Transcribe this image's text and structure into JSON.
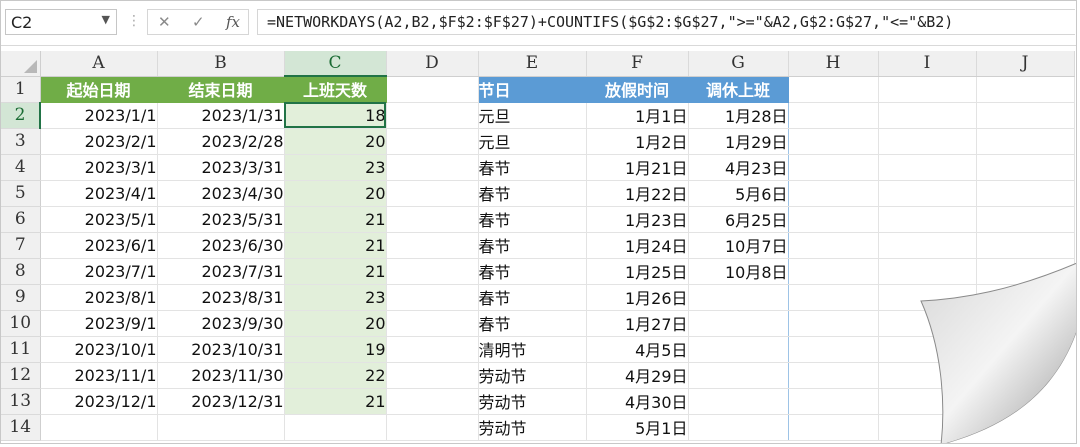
{
  "formula_bar": {
    "cell_ref": "C2",
    "cancel_icon": "✕",
    "enter_icon": "✓",
    "fx_label": "fx",
    "formula": "=NETWORKDAYS(A2,B2,$F$2:$F$27)+COUNTIFS($G$2:$G$27,\">=\"&A2,G$2:G$27,\"<=\"&B2)"
  },
  "columns": [
    "A",
    "B",
    "C",
    "D",
    "E",
    "F",
    "G",
    "H",
    "I",
    "J"
  ],
  "selected_column": "C",
  "selected_row": "2",
  "rows": [
    "1",
    "2",
    "3",
    "4",
    "5",
    "6",
    "7",
    "8",
    "9",
    "10",
    "11",
    "12",
    "13",
    "14"
  ],
  "headers": {
    "start_date": "起始日期",
    "end_date": "结束日期",
    "workdays": "上班天数",
    "holiday": "节日",
    "holiday_date": "放假时间",
    "makeup_workday": "调休上班"
  },
  "table1": [
    {
      "start": "2023/1/1",
      "end": "2023/1/31",
      "days": "18"
    },
    {
      "start": "2023/2/1",
      "end": "2023/2/28",
      "days": "20"
    },
    {
      "start": "2023/3/1",
      "end": "2023/3/31",
      "days": "23"
    },
    {
      "start": "2023/4/1",
      "end": "2023/4/30",
      "days": "20"
    },
    {
      "start": "2023/5/1",
      "end": "2023/5/31",
      "days": "21"
    },
    {
      "start": "2023/6/1",
      "end": "2023/6/30",
      "days": "21"
    },
    {
      "start": "2023/7/1",
      "end": "2023/7/31",
      "days": "21"
    },
    {
      "start": "2023/8/1",
      "end": "2023/8/31",
      "days": "23"
    },
    {
      "start": "2023/9/1",
      "end": "2023/9/30",
      "days": "20"
    },
    {
      "start": "2023/10/1",
      "end": "2023/10/31",
      "days": "19"
    },
    {
      "start": "2023/11/1",
      "end": "2023/11/30",
      "days": "22"
    },
    {
      "start": "2023/12/1",
      "end": "2023/12/31",
      "days": "21"
    }
  ],
  "table2": [
    {
      "name": "元旦",
      "date": "1月1日",
      "makeup": "1月28日"
    },
    {
      "name": "元旦",
      "date": "1月2日",
      "makeup": "1月29日"
    },
    {
      "name": "春节",
      "date": "1月21日",
      "makeup": "4月23日"
    },
    {
      "name": "春节",
      "date": "1月22日",
      "makeup": "5月6日"
    },
    {
      "name": "春节",
      "date": "1月23日",
      "makeup": "6月25日"
    },
    {
      "name": "春节",
      "date": "1月24日",
      "makeup": "10月7日"
    },
    {
      "name": "春节",
      "date": "1月25日",
      "makeup": "10月8日"
    },
    {
      "name": "春节",
      "date": "1月26日",
      "makeup": ""
    },
    {
      "name": "春节",
      "date": "1月27日",
      "makeup": ""
    },
    {
      "name": "清明节",
      "date": "4月5日",
      "makeup": ""
    },
    {
      "name": "劳动节",
      "date": "4月29日",
      "makeup": ""
    },
    {
      "name": "劳动节",
      "date": "4月30日",
      "makeup": ""
    },
    {
      "name": "劳动节",
      "date": "5月1日",
      "makeup": ""
    }
  ],
  "colors": {
    "green_header": "#70ad47",
    "green_fill": "#e2efda",
    "blue_header": "#5b9bd5",
    "selection": "#217346"
  }
}
